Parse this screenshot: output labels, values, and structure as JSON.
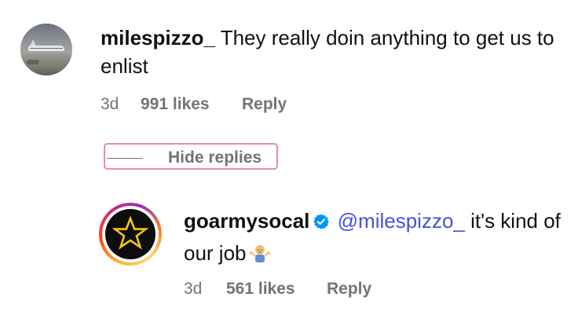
{
  "comment": {
    "username": "milespizzo_",
    "text": " They really doin anything to get us to enlist",
    "time": "3d",
    "likes": "991 likes",
    "reply_label": "Reply"
  },
  "hide_replies": {
    "label": "Hide replies"
  },
  "reply": {
    "username": "goarmysocal",
    "mention": "@milespizzo_",
    "text": " it's kind of our job",
    "time": "3d",
    "likes": "561 likes",
    "reply_label": "Reply"
  },
  "colors": {
    "mention": "#4a4fd8",
    "meta": "#737373",
    "verified": "#0095f6",
    "highlight_border": "#e58bb4"
  }
}
